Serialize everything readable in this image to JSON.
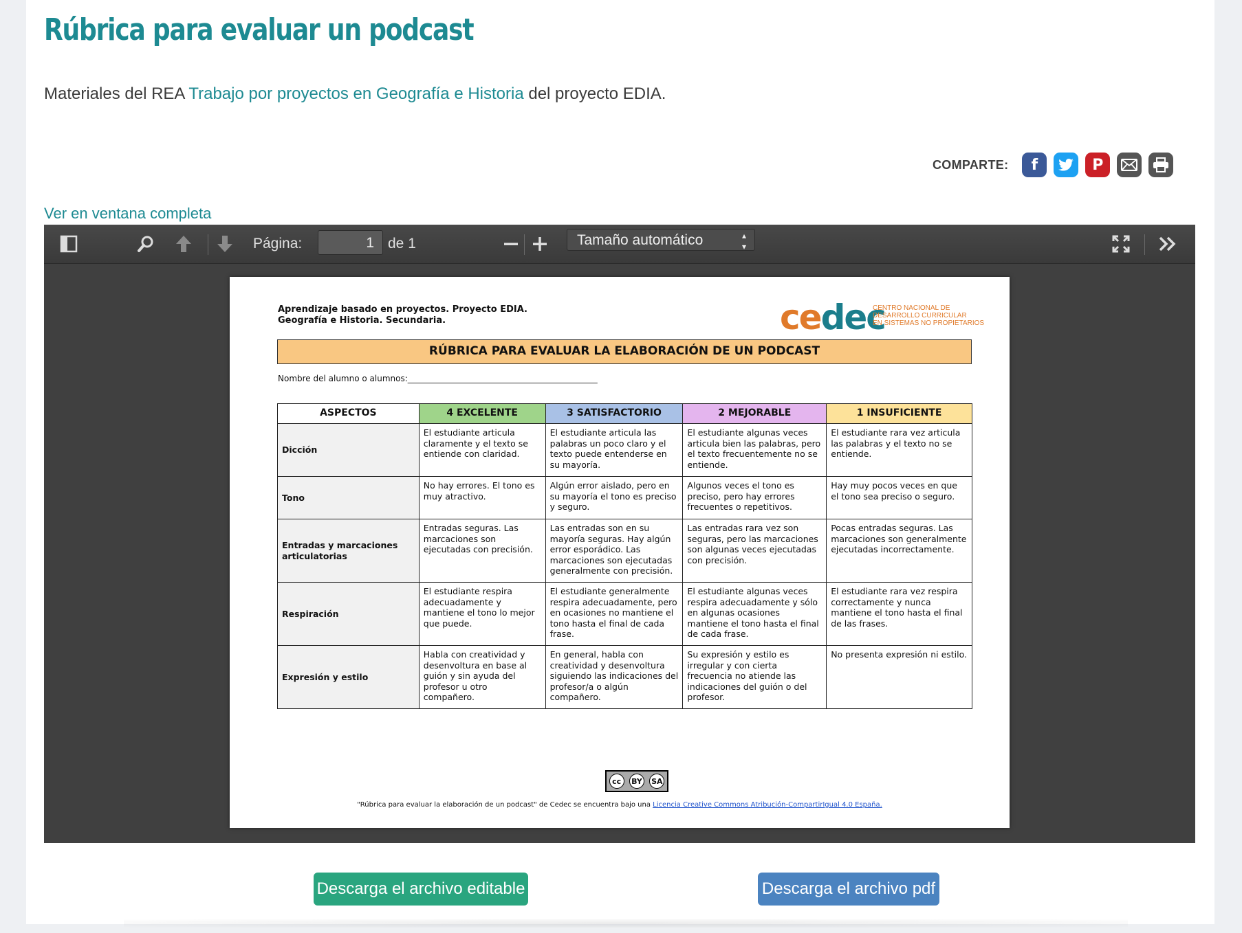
{
  "page": {
    "title": "Rúbrica para evaluar un podcast",
    "subtitle_prefix": "Materiales del REA ",
    "subtitle_link": "Trabajo por proyectos en Geografía e Historia",
    "subtitle_suffix": " del proyecto EDIA.",
    "share_label": "COMPARTE:",
    "share_icons": [
      "facebook-icon",
      "twitter-icon",
      "pinterest-icon",
      "email-icon",
      "print-icon"
    ],
    "full_window_link": "Ver en ventana completa"
  },
  "viewer": {
    "page_label": "Página:",
    "page_value": "1",
    "page_total": "de 1",
    "zoom_value": "Tamaño automático"
  },
  "document": {
    "header_line1": "Aprendizaje basado en proyectos. Proyecto EDIA.",
    "header_line2": "Geografía e Historia. Secundaria.",
    "logo_text_a": "ce",
    "logo_text_b": "dec",
    "logo_sub1": "CENTRO NACIONAL DE",
    "logo_sub2": "DESARROLLO CURRICULAR",
    "logo_sub3": "EN SISTEMAS NO PROPIETARIOS",
    "banner": "RÚBRICA PARA EVALUAR LA ELABORACIÓN DE UN PODCAST",
    "nombre_label": "Nombre del  alumno o alumnos:______________________________________________",
    "columns": [
      "ASPECTOS",
      "4 EXCELENTE",
      "3 SATISFACTORIO",
      "2 MEJORABLE",
      "1 INSUFICIENTE"
    ],
    "column_colors": [
      "#ffffff",
      "#9fd48a",
      "#a9c1e6",
      "#e4b5ee",
      "#fde29a"
    ],
    "rows": [
      {
        "aspect": "Dicción",
        "cells": [
          "El estudiante articula claramente y el texto se entiende con claridad.",
          "El estudiante articula las palabras un poco claro y el texto puede entenderse en su mayoría.",
          "El estudiante algunas veces articula bien las palabras, pero el texto frecuentemente no se entiende.",
          "El estudiante rara vez articula las palabras y el texto no se entiende."
        ]
      },
      {
        "aspect": "Tono",
        "cells": [
          "No hay errores. El tono es muy atractivo.",
          "Algún error aislado, pero en su mayoría el tono es preciso y seguro.",
          "Algunos veces  el tono es preciso, pero hay errores frecuentes o repetitivos.",
          "Hay muy pocos veces en que el tono sea preciso o seguro."
        ]
      },
      {
        "aspect": "Entradas y marcaciones articulatorias",
        "cells": [
          "Entradas seguras. Las marcaciones son ejecutadas con precisión.",
          "Las entradas son en su mayoría seguras. Hay algún error esporádico. Las marcaciones son ejecutadas generalmente con precisión.",
          "Las entradas rara vez son seguras, pero las marcaciones son algunas veces ejecutadas con precisión.",
          "Pocas entradas seguras. Las marcaciones son generalmente ejecutadas incorrectamente."
        ]
      },
      {
        "aspect": "Respiración",
        "cells": [
          "El estudiante respira adecuadamente y mantiene el tono lo mejor que puede.",
          "El estudiante generalmente respira adecuadamente, pero en ocasiones no mantiene el tono hasta el final de cada frase.",
          "El estudiante algunas veces respira adecuadamente y sólo en algunas ocasiones mantiene el tono hasta el final de cada frase.",
          "El estudiante rara vez respira correctamente y nunca mantiene el tono hasta el final de las frases."
        ]
      },
      {
        "aspect": "Expresión y estilo",
        "cells": [
          "Habla con creatividad y desenvoltura en base al guión y sin ayuda del profesor u otro compañero.",
          "En general, habla con creatividad y desenvoltura siguiendo las indicaciones del profesor/a o algún compañero.",
          "Su expresión y estilo es irregular y con cierta frecuencia no atiende las indicaciones del guión o del profesor.",
          "No presenta expresión ni estilo."
        ]
      }
    ],
    "cc_by": "BY",
    "cc_sa": "SA",
    "footer_text": "\"Rúbrica para evaluar la elaboración de un podcast\" de Cedec se encuentra bajo una ",
    "footer_link": "Licencia Creative Commons Atribución-CompartirIgual 4.0 España."
  },
  "buttons": {
    "editable": "Descarga el archivo editable",
    "pdf": "Descarga el archivo pdf"
  },
  "colors": {
    "accent": "#1d8a92",
    "btn_editable": "#2aa57f",
    "btn_pdf": "#4b83c0",
    "facebook": "#3b5998",
    "twitter": "#1da1f2",
    "pinterest": "#cb2027",
    "email": "#555555",
    "print": "#555555",
    "banner": "#f9c782"
  }
}
